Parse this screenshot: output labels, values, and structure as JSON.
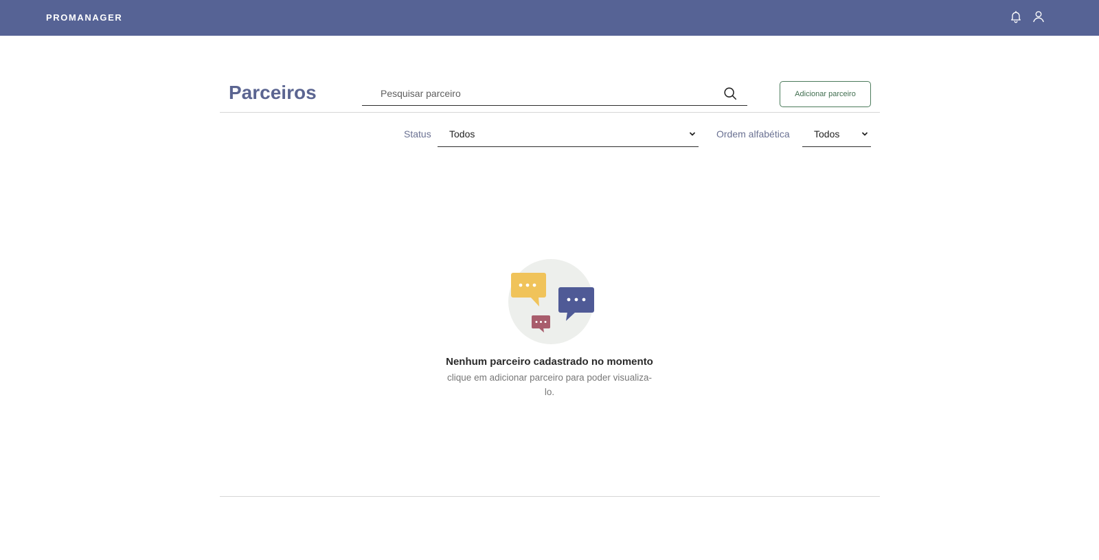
{
  "app": {
    "brand": "PROMANAGER",
    "icons": {
      "notifications": "bell-icon",
      "profile": "user-icon"
    },
    "colors": {
      "header": "#566395",
      "title": "#5b6591",
      "add_button": "#3f6d4e"
    }
  },
  "page": {
    "title": "Parceiros",
    "search": {
      "placeholder": "Pesquisar parceiro",
      "value": "",
      "icon": "search-icon"
    },
    "add_button_label": "Adicionar parceiro"
  },
  "filters": {
    "status": {
      "label": "Status",
      "value": "Todos"
    },
    "order": {
      "label": "Ordem alfabética",
      "value": "Todos"
    }
  },
  "empty_state": {
    "title": "Nenhum parceiro cadastrado no momento",
    "subtitle": "clique em adicionar parceiro para poder visualiza-lo.",
    "colors": {
      "circle": "#edefec",
      "yellow_bubble": "#f0c35a",
      "blue_bubble": "#4f5a96",
      "red_bubble": "#a85d6c"
    }
  }
}
